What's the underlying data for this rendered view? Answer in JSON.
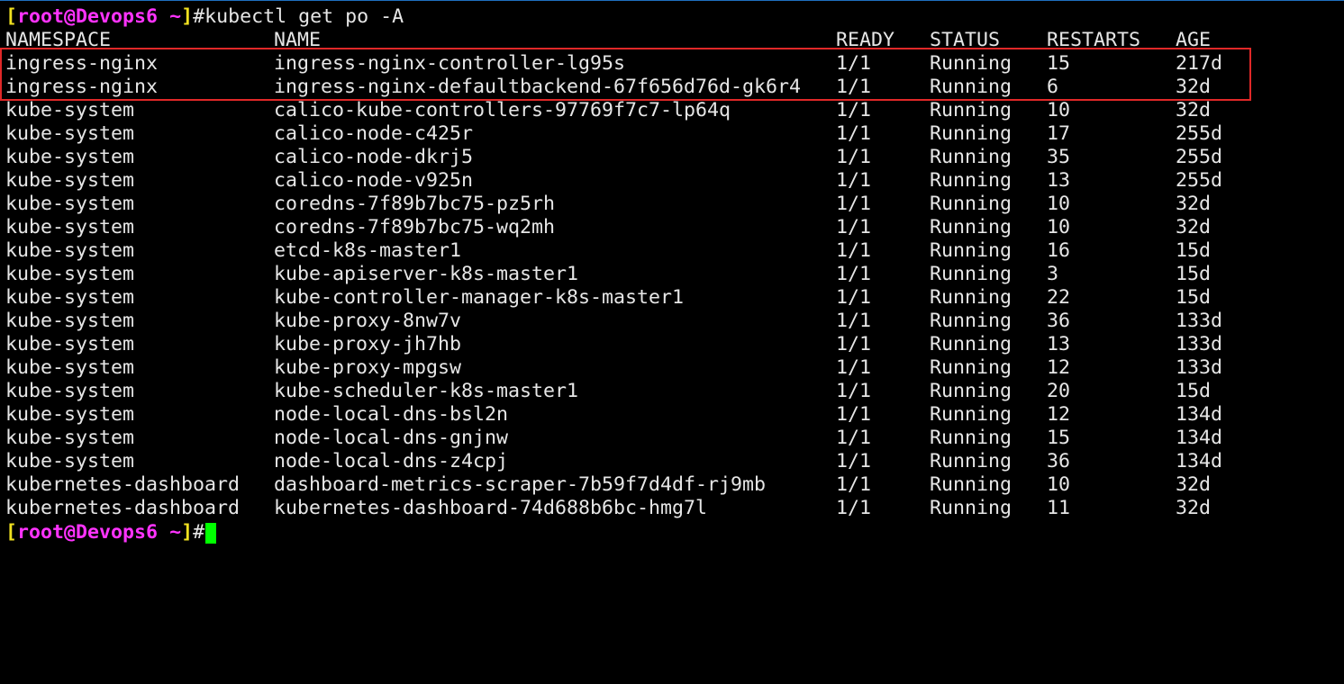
{
  "terminal": {
    "prompt": {
      "open_bracket": "[",
      "user": "root",
      "at": "@",
      "host": "Devops6",
      "path": " ~",
      "close_bracket": "]",
      "hash": "#"
    },
    "command": "kubectl get po -A",
    "headers": {
      "namespace": "NAMESPACE",
      "name": "NAME",
      "ready": "READY",
      "status": "STATUS",
      "restarts": "RESTARTS",
      "age": "AGE"
    },
    "rows": [
      {
        "namespace": "ingress-nginx",
        "name": "ingress-nginx-controller-lg95s",
        "ready": "1/1",
        "status": "Running",
        "restarts": "15",
        "age": "217d"
      },
      {
        "namespace": "ingress-nginx",
        "name": "ingress-nginx-defaultbackend-67f656d76d-gk6r4",
        "ready": "1/1",
        "status": "Running",
        "restarts": "6",
        "age": "32d"
      },
      {
        "namespace": "kube-system",
        "name": "calico-kube-controllers-97769f7c7-lp64q",
        "ready": "1/1",
        "status": "Running",
        "restarts": "10",
        "age": "32d"
      },
      {
        "namespace": "kube-system",
        "name": "calico-node-c425r",
        "ready": "1/1",
        "status": "Running",
        "restarts": "17",
        "age": "255d"
      },
      {
        "namespace": "kube-system",
        "name": "calico-node-dkrj5",
        "ready": "1/1",
        "status": "Running",
        "restarts": "35",
        "age": "255d"
      },
      {
        "namespace": "kube-system",
        "name": "calico-node-v925n",
        "ready": "1/1",
        "status": "Running",
        "restarts": "13",
        "age": "255d"
      },
      {
        "namespace": "kube-system",
        "name": "coredns-7f89b7bc75-pz5rh",
        "ready": "1/1",
        "status": "Running",
        "restarts": "10",
        "age": "32d"
      },
      {
        "namespace": "kube-system",
        "name": "coredns-7f89b7bc75-wq2mh",
        "ready": "1/1",
        "status": "Running",
        "restarts": "10",
        "age": "32d"
      },
      {
        "namespace": "kube-system",
        "name": "etcd-k8s-master1",
        "ready": "1/1",
        "status": "Running",
        "restarts": "16",
        "age": "15d"
      },
      {
        "namespace": "kube-system",
        "name": "kube-apiserver-k8s-master1",
        "ready": "1/1",
        "status": "Running",
        "restarts": "3",
        "age": "15d"
      },
      {
        "namespace": "kube-system",
        "name": "kube-controller-manager-k8s-master1",
        "ready": "1/1",
        "status": "Running",
        "restarts": "22",
        "age": "15d"
      },
      {
        "namespace": "kube-system",
        "name": "kube-proxy-8nw7v",
        "ready": "1/1",
        "status": "Running",
        "restarts": "36",
        "age": "133d"
      },
      {
        "namespace": "kube-system",
        "name": "kube-proxy-jh7hb",
        "ready": "1/1",
        "status": "Running",
        "restarts": "13",
        "age": "133d"
      },
      {
        "namespace": "kube-system",
        "name": "kube-proxy-mpgsw",
        "ready": "1/1",
        "status": "Running",
        "restarts": "12",
        "age": "133d"
      },
      {
        "namespace": "kube-system",
        "name": "kube-scheduler-k8s-master1",
        "ready": "1/1",
        "status": "Running",
        "restarts": "20",
        "age": "15d"
      },
      {
        "namespace": "kube-system",
        "name": "node-local-dns-bsl2n",
        "ready": "1/1",
        "status": "Running",
        "restarts": "12",
        "age": "134d"
      },
      {
        "namespace": "kube-system",
        "name": "node-local-dns-gnjnw",
        "ready": "1/1",
        "status": "Running",
        "restarts": "15",
        "age": "134d"
      },
      {
        "namespace": "kube-system",
        "name": "node-local-dns-z4cpj",
        "ready": "1/1",
        "status": "Running",
        "restarts": "36",
        "age": "134d"
      },
      {
        "namespace": "kubernetes-dashboard",
        "name": "dashboard-metrics-scraper-7b59f7d4df-rj9mb",
        "ready": "1/1",
        "status": "Running",
        "restarts": "10",
        "age": "32d"
      },
      {
        "namespace": "kubernetes-dashboard",
        "name": "kubernetes-dashboard-74d688b6bc-hmg7l",
        "ready": "1/1",
        "status": "Running",
        "restarts": "11",
        "age": "32d"
      }
    ],
    "colors": {
      "background": "#000000",
      "text": "#e6e6e6",
      "bracket": "#f0e020",
      "user_host": "#ff33ff",
      "cursor": "#00ff00",
      "highlight_border": "#e02828"
    }
  }
}
